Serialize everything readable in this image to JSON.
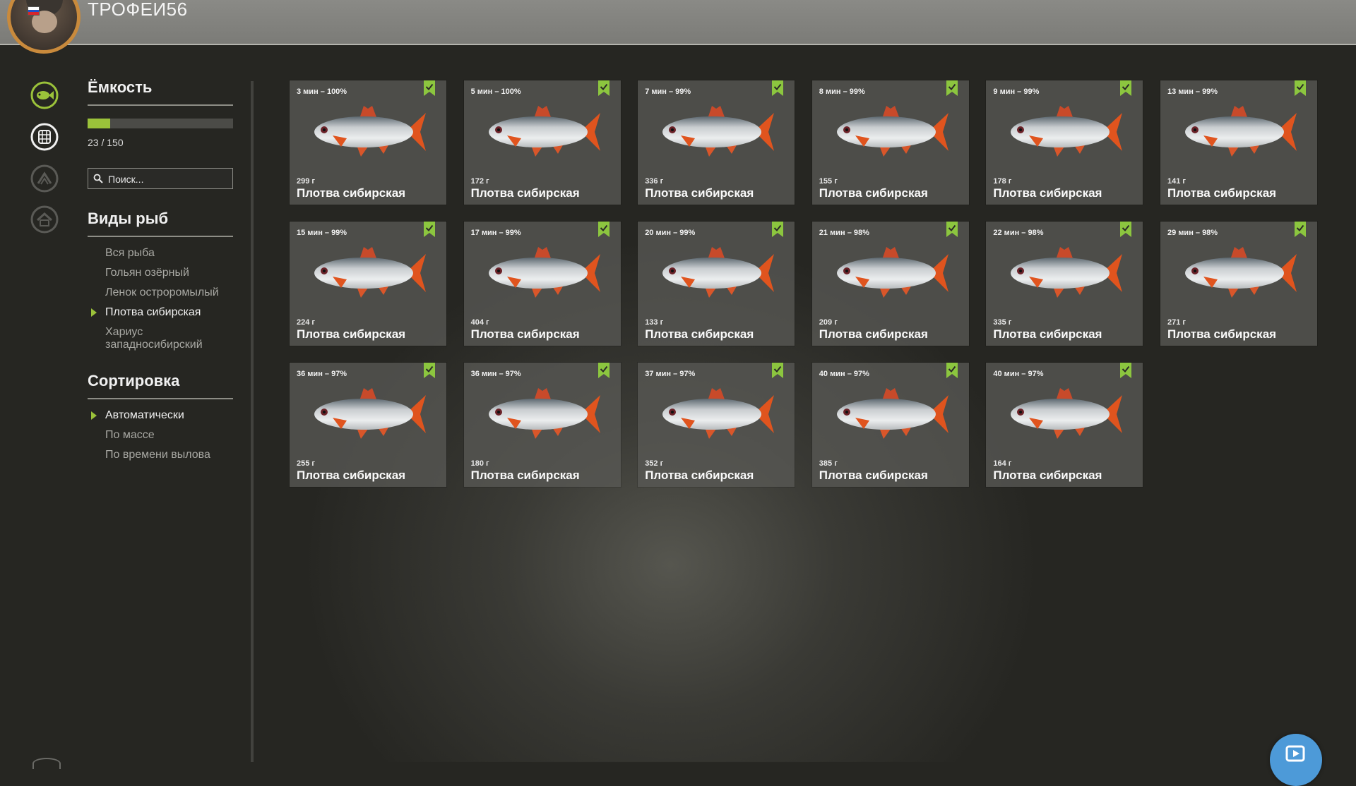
{
  "header": {
    "title": "ТРОФЕИ56"
  },
  "flag": {
    "colors": [
      "#ffffff",
      "#2050c8",
      "#d8262a"
    ]
  },
  "rail": {
    "icons": [
      {
        "name": "fish-icon",
        "active": true
      },
      {
        "name": "keepnet-icon",
        "active": false
      },
      {
        "name": "triangle-arrow-icon",
        "active": false
      },
      {
        "name": "home-icon",
        "active": false
      }
    ]
  },
  "capacity": {
    "title": "Ёмкость",
    "current": 23,
    "max": 150,
    "label": "23 / 150",
    "fill_color": "#9bc23a"
  },
  "search": {
    "placeholder": "Поиск..."
  },
  "species": {
    "title": "Виды рыб",
    "items": [
      {
        "label": "Вся рыба",
        "active": false
      },
      {
        "label": "Гольян озёрный",
        "active": false
      },
      {
        "label": "Ленок остроромылый",
        "active": false
      },
      {
        "label": "Плотва сибирская",
        "active": true
      },
      {
        "label": "Хариус западносибирский",
        "active": false
      }
    ]
  },
  "sorting": {
    "title": "Сортировка",
    "items": [
      {
        "label": "Автоматически",
        "active": true
      },
      {
        "label": "По массе",
        "active": false
      },
      {
        "label": "По времени вылова",
        "active": false
      }
    ]
  },
  "fish": [
    {
      "time": "3 мин – 100%",
      "weight": "299 г",
      "name": "Плотва сибирская"
    },
    {
      "time": "5 мин – 100%",
      "weight": "172 г",
      "name": "Плотва сибирская"
    },
    {
      "time": "7 мин – 99%",
      "weight": "336 г",
      "name": "Плотва сибирская"
    },
    {
      "time": "8 мин – 99%",
      "weight": "155 г",
      "name": "Плотва сибирская"
    },
    {
      "time": "9 мин – 99%",
      "weight": "178 г",
      "name": "Плотва сибирская"
    },
    {
      "time": "13 мин – 99%",
      "weight": "141 г",
      "name": "Плотва сибирская"
    },
    {
      "time": "15 мин – 99%",
      "weight": "224 г",
      "name": "Плотва сибирская"
    },
    {
      "time": "17 мин – 99%",
      "weight": "404 г",
      "name": "Плотва сибирская"
    },
    {
      "time": "20 мин – 99%",
      "weight": "133 г",
      "name": "Плотва сибирская"
    },
    {
      "time": "21 мин – 98%",
      "weight": "209 г",
      "name": "Плотва сибирская"
    },
    {
      "time": "22 мин – 98%",
      "weight": "335 г",
      "name": "Плотва сибирская"
    },
    {
      "time": "29 мин – 98%",
      "weight": "271 г",
      "name": "Плотва сибирская"
    },
    {
      "time": "36 мин – 97%",
      "weight": "255 г",
      "name": "Плотва сибирская"
    },
    {
      "time": "36 мин – 97%",
      "weight": "180 г",
      "name": "Плотва сибирская"
    },
    {
      "time": "37 мин – 97%",
      "weight": "352 г",
      "name": "Плотва сибирская"
    },
    {
      "time": "40 мин – 97%",
      "weight": "385 г",
      "name": "Плотва сибирская"
    },
    {
      "time": "40 мин – 97%",
      "weight": "164 г",
      "name": "Плотва сибирская"
    }
  ],
  "colors": {
    "accent": "#9bc23a",
    "bookmark": "#8cc63f",
    "action_button": "#4d9ad8"
  }
}
